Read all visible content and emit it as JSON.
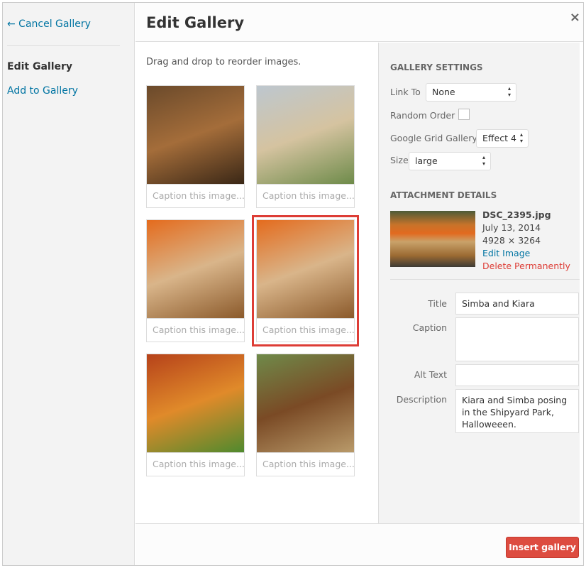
{
  "sidebar": {
    "cancel": "← Cancel Gallery",
    "current": "Edit Gallery",
    "add": "Add to Gallery"
  },
  "header": {
    "title": "Edit Gallery",
    "close": "×"
  },
  "main": {
    "hint": "Drag and drop to reorder images.",
    "images": [
      {
        "caption_placeholder": "Caption this image...",
        "selected": false,
        "colors": [
          "#6b4a2b",
          "#a46d3a",
          "#3a2716"
        ]
      },
      {
        "caption_placeholder": "Caption this image...",
        "selected": false,
        "colors": [
          "#bdc7cf",
          "#d5c3a0",
          "#6e8b4a"
        ]
      },
      {
        "caption_placeholder": "Caption this image...",
        "selected": false,
        "colors": [
          "#e46b1d",
          "#d9b58a",
          "#8b5a2b"
        ]
      },
      {
        "caption_placeholder": "Caption this image...",
        "selected": true,
        "colors": [
          "#e46b1d",
          "#d9b58a",
          "#8b5a2b"
        ]
      },
      {
        "caption_placeholder": "Caption this image...",
        "selected": false,
        "colors": [
          "#b6421a",
          "#e08a2a",
          "#4f8a2e"
        ]
      },
      {
        "caption_placeholder": "Caption this image...",
        "selected": false,
        "colors": [
          "#6f8a4a",
          "#7a4a25",
          "#b99a6a"
        ]
      }
    ]
  },
  "settings": {
    "heading": "Gallery Settings",
    "link_to_label": "Link To",
    "link_to_value": "None",
    "random_label": "Random Order",
    "random_checked": false,
    "grid_label": "Google Grid Gallery",
    "grid_value": "Effect 4",
    "size_label": "Size",
    "size_value": "large"
  },
  "attachment": {
    "heading": "Attachment Details",
    "filename": "DSC_2395.jpg",
    "date": "July 13, 2014",
    "dimensions": "4928 × 3264",
    "edit": "Edit Image",
    "delete": "Delete Permanently",
    "title_label": "Title",
    "title_value": "Simba and Kiara",
    "caption_label": "Caption",
    "caption_value": "",
    "alt_label": "Alt Text",
    "alt_value": "",
    "desc_label": "Description",
    "desc_value": "Kiara and Simba posing in the Shipyard Park, Halloweeen."
  },
  "footer": {
    "insert": "Insert gallery"
  },
  "colors": {
    "link": "#0074a2",
    "danger": "#dd3d36",
    "button": "#dd4c40"
  }
}
